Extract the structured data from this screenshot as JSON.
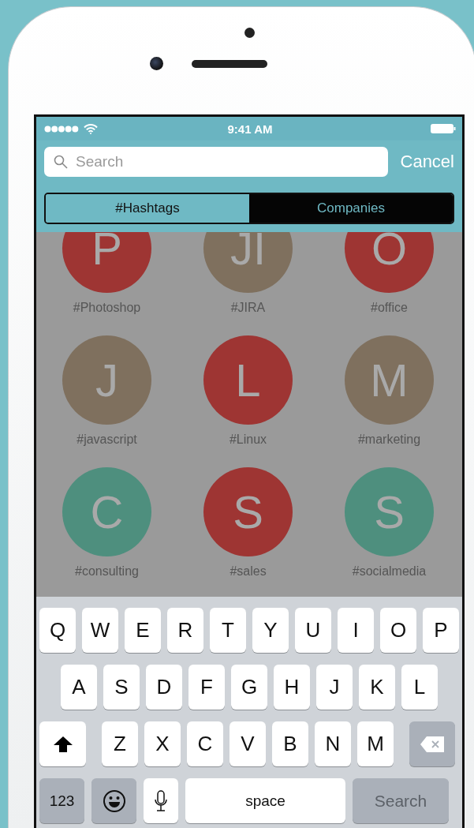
{
  "status_bar": {
    "time": "9:41 AM"
  },
  "search": {
    "placeholder": "Search",
    "cancel": "Cancel"
  },
  "tabs": [
    {
      "label": "#Hashtags",
      "selected": true
    },
    {
      "label": "Companies",
      "selected": false
    }
  ],
  "hashtags": [
    {
      "letter": "P",
      "label": "#Photoshop",
      "color": "#9e3533"
    },
    {
      "letter": "JI",
      "label": "#JIRA",
      "color": "#7f705e"
    },
    {
      "letter": "O",
      "label": "#office",
      "color": "#9e3533"
    },
    {
      "letter": "J",
      "label": "#javascript",
      "color": "#7f705e"
    },
    {
      "letter": "L",
      "label": "#Linux",
      "color": "#9e3533"
    },
    {
      "letter": "M",
      "label": "#marketing",
      "color": "#7f705e"
    },
    {
      "letter": "C",
      "label": "#consulting",
      "color": "#4e8f7e"
    },
    {
      "letter": "S",
      "label": "#sales",
      "color": "#9e3533"
    },
    {
      "letter": "S",
      "label": "#socialmedia",
      "color": "#4e8f7e"
    }
  ],
  "keyboard": {
    "rows": [
      {
        "keys": [
          {
            "kind": "letter",
            "label": "Q"
          },
          {
            "kind": "letter",
            "label": "W"
          },
          {
            "kind": "letter",
            "label": "E"
          },
          {
            "kind": "letter",
            "label": "R"
          },
          {
            "kind": "letter",
            "label": "T"
          },
          {
            "kind": "letter",
            "label": "Y"
          },
          {
            "kind": "letter",
            "label": "U"
          },
          {
            "kind": "letter",
            "label": "I"
          },
          {
            "kind": "letter",
            "label": "O"
          },
          {
            "kind": "letter",
            "label": "P"
          }
        ]
      },
      {
        "keys": [
          {
            "kind": "letter",
            "label": "A"
          },
          {
            "kind": "letter",
            "label": "S"
          },
          {
            "kind": "letter",
            "label": "D"
          },
          {
            "kind": "letter",
            "label": "F"
          },
          {
            "kind": "letter",
            "label": "G"
          },
          {
            "kind": "letter",
            "label": "H"
          },
          {
            "kind": "letter",
            "label": "J"
          },
          {
            "kind": "letter",
            "label": "K"
          },
          {
            "kind": "letter",
            "label": "L"
          }
        ]
      },
      {
        "keys": [
          {
            "kind": "shift"
          },
          {
            "kind": "letter",
            "label": "Z"
          },
          {
            "kind": "letter",
            "label": "X"
          },
          {
            "kind": "letter",
            "label": "C"
          },
          {
            "kind": "letter",
            "label": "V"
          },
          {
            "kind": "letter",
            "label": "B"
          },
          {
            "kind": "letter",
            "label": "N"
          },
          {
            "kind": "letter",
            "label": "M"
          },
          {
            "kind": "delete"
          }
        ]
      },
      {
        "keys": [
          {
            "kind": "mode",
            "label": "123"
          },
          {
            "kind": "emoji"
          },
          {
            "kind": "mic"
          },
          {
            "kind": "space",
            "label": "space"
          },
          {
            "kind": "action",
            "label": "Search"
          }
        ]
      }
    ]
  }
}
